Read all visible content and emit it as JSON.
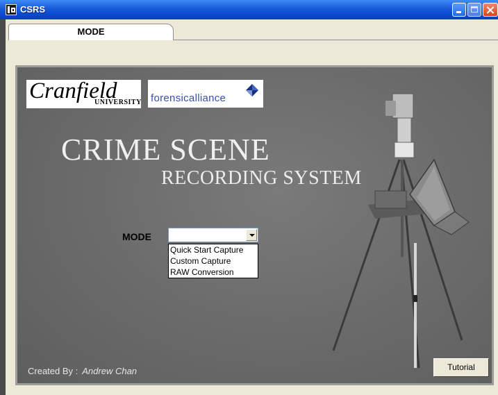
{
  "window": {
    "title": "CSRS",
    "app_icon": "csrs-app-icon"
  },
  "tabs": [
    {
      "label": "MODE"
    }
  ],
  "logos": {
    "cranfield_main": "Cranfield",
    "cranfield_sub": "UNIVERSITY",
    "forensic": "forensicalliance"
  },
  "headline": {
    "line1": "CRIME SCENE",
    "line2": "RECORDING SYSTEM"
  },
  "mode": {
    "label": "MODE",
    "selected_value": "",
    "options": [
      "Quick Start Capture",
      "Custom Capture",
      "RAW Conversion"
    ]
  },
  "footer": {
    "created_by_label": "Created By :",
    "author": "Andrew Chan"
  },
  "buttons": {
    "tutorial": "Tutorial"
  },
  "colors": {
    "titlebar": "#0c4bd0",
    "panel": "#6e6e6e",
    "forensic_text": "#3a4fb0"
  }
}
